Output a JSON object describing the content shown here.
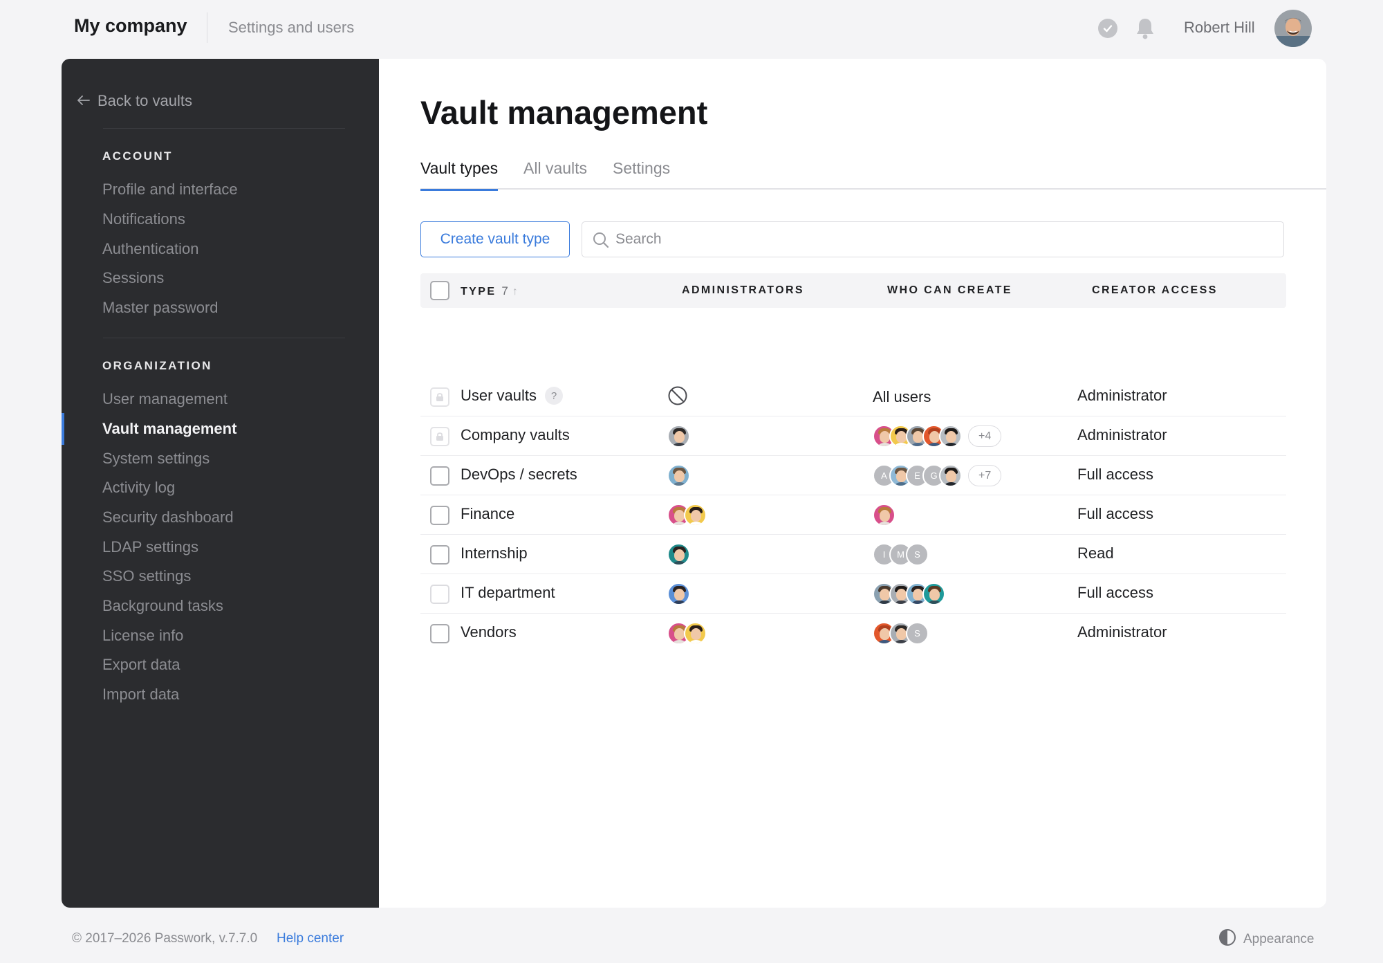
{
  "header": {
    "brand": "My company",
    "breadcrumb": "Settings and users",
    "user_name": "Robert Hill"
  },
  "sidebar": {
    "back_label": "Back to vaults",
    "account_heading": "ACCOUNT",
    "account_items": [
      "Profile and interface",
      "Notifications",
      "Authentication",
      "Sessions",
      "Master password"
    ],
    "org_heading": "ORGANIZATION",
    "org_items": [
      "User management",
      "Vault management",
      "System settings",
      "Activity log",
      "Security dashboard",
      "LDAP settings",
      "SSO settings",
      "Background tasks",
      "License info",
      "Export data",
      "Import data"
    ],
    "active_item": "Vault management"
  },
  "main": {
    "title": "Vault management",
    "tabs": [
      "Vault types",
      "All vaults",
      "Settings"
    ],
    "active_tab": "Vault types",
    "create_label": "Create vault type",
    "search_placeholder": "Search"
  },
  "table": {
    "headers": {
      "type": "TYPE",
      "type_count": "7",
      "sort": "↑",
      "admins": "ADMINISTRATORS",
      "creators": "WHO CAN CREATE",
      "access": "CREATOR ACCESS"
    },
    "rows": [
      {
        "type": "User vaults",
        "help": "?",
        "creators_text": "All users",
        "creators_more": "",
        "access": "Administrator"
      },
      {
        "type": "Company vaults",
        "creators_more": "+4",
        "access": "Administrator"
      },
      {
        "type": "DevOps / secrets",
        "creators_more": "+7",
        "access": "Full access",
        "letters": [
          "A",
          "E",
          "G"
        ]
      },
      {
        "type": "Finance",
        "creators_more": "",
        "access": "Full access"
      },
      {
        "type": "Internship",
        "creators_more": "",
        "access": "Read",
        "letters": [
          "I",
          "M",
          "S"
        ]
      },
      {
        "type": "IT department",
        "creators_more": "",
        "access": "Full access"
      },
      {
        "type": "Vendors",
        "creators_more": "",
        "access": "Administrator",
        "letters": [
          "S"
        ]
      }
    ]
  },
  "footer": {
    "copyright": "© 2017–2026 Passwork, v.7.7.0",
    "help": "Help center",
    "appearance": "Appearance"
  },
  "colors": {
    "accent": "#3a7bdc",
    "sidebar_bg": "#2b2c2f",
    "page_bg": "#f4f4f6"
  },
  "icons": [
    "check-circle-icon",
    "bell-icon",
    "arrow-left-icon",
    "search-icon",
    "lock-icon",
    "help-icon",
    "blocked-icon",
    "sort-arrow-icon",
    "contrast-icon"
  ]
}
